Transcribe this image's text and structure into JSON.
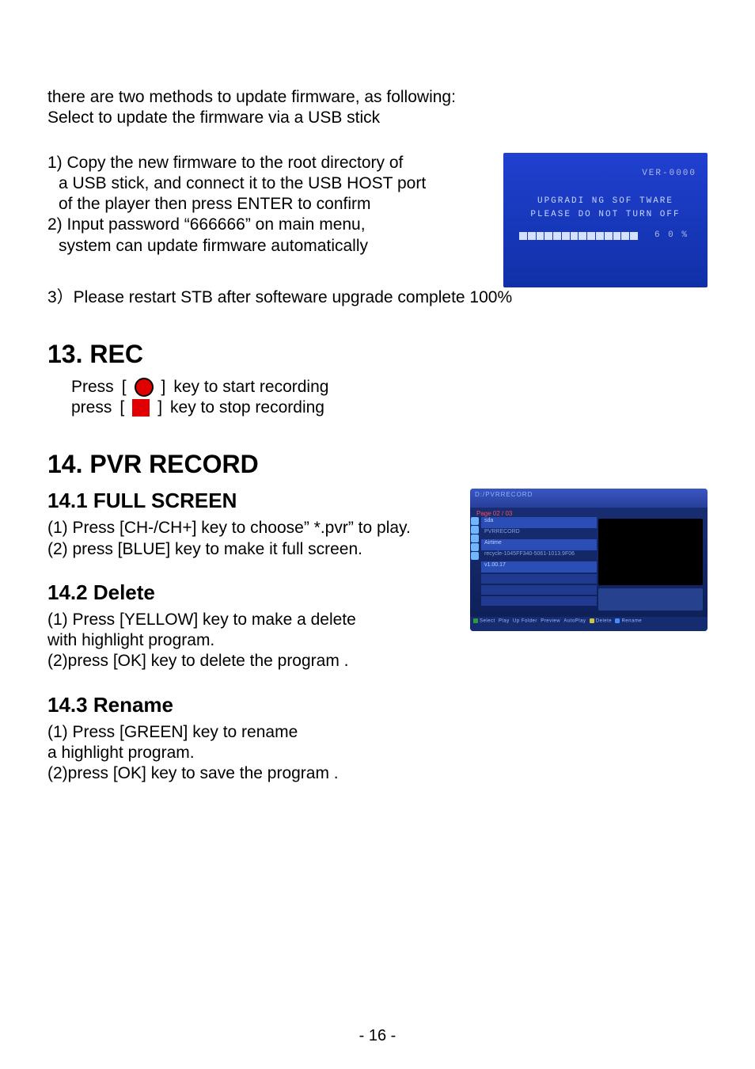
{
  "intro": {
    "line1": "there are two methods to update firmware, as following:",
    "line2": "Select to update the firmware via a USB stick"
  },
  "steps": {
    "s1a": "1) Copy the new firmware to the root directory of",
    "s1b": "a USB stick, and connect it to the USB HOST port",
    "s1c": "of the player then press ENTER to confirm",
    "s2a": "2) Input password “666666” on main menu,",
    "s2b": "system can update firmware automatically",
    "s3": "3）Please restart STB after softeware upgrade complete 100%"
  },
  "fig_upgrade": {
    "version": "VER-0000",
    "line1": "UPGRADI NG  SOF TWARE",
    "line2": "PLEASE  DO  NOT  TURN  OFF",
    "percent": "6 0 %"
  },
  "h_rec": "13. REC",
  "rec": {
    "press": "Press",
    "press2": "press",
    "lb": "[",
    "rb": "]",
    "start": "key to start recording",
    "stop": "key to stop recording"
  },
  "h_pvr": "14. PVR RECORD",
  "s141": {
    "h": "14.1   FULL SCREEN",
    "l1": "(1) Press [CH-/CH+] key to choose” *.pvr” to play.",
    "l2": "(2) press [BLUE] key to make it full screen."
  },
  "s142": {
    "h": "14.2   Delete",
    "l1": "(1) Press [YELLOW] key to make a delete",
    "l2": "with highlight program.",
    "l3": "(2)press [OK] key to delete the program ."
  },
  "s143": {
    "h": "14.3   Rename",
    "l1": "(1) Press [GREEN] key to rename",
    "l2": "a highlight program.",
    "l3": "(2)press [OK] key to save the program ."
  },
  "fig_pvr": {
    "title": "D:/PVRRECORD",
    "page": "Page  02 / 03",
    "rows": [
      "sda",
      "PVRRECORD",
      "Airtime",
      "recycle-1045FF340-5061-1013.9F06",
      "v1.00.17"
    ],
    "footer_select": "Select",
    "footer_play": "Play",
    "footer_upfolder": "Up Folder",
    "footer_preview": "Preview",
    "footer_autoplay": "AutoPlay",
    "footer_delete": "Delete",
    "footer_rename": "Rename"
  },
  "page_number": "- 16 -"
}
